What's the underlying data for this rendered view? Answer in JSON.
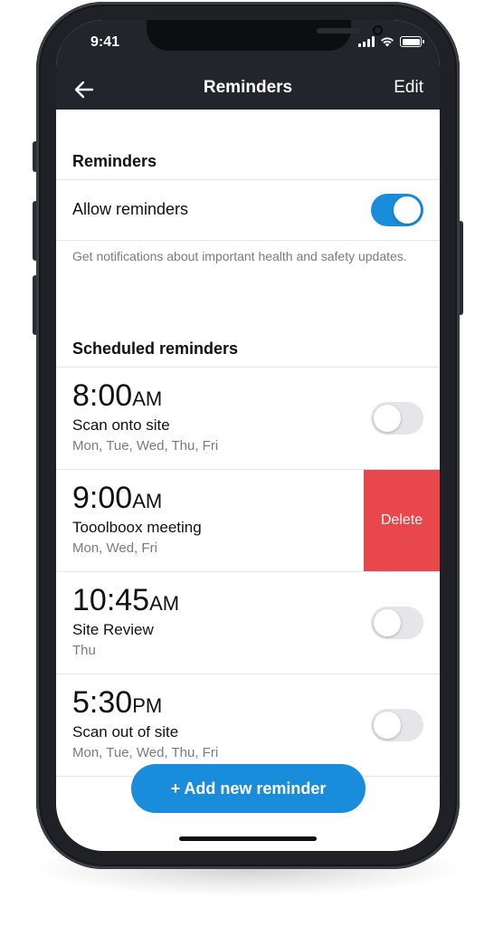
{
  "status_bar": {
    "time": "9:41"
  },
  "nav": {
    "title": "Reminders",
    "edit_label": "Edit"
  },
  "settings": {
    "heading": "Reminders",
    "allow_label": "Allow reminders",
    "allow_enabled": true,
    "hint": "Get notifications about important health and safety updates."
  },
  "scheduled": {
    "heading": "Scheduled reminders",
    "items": [
      {
        "time": "8:00",
        "period": "AM",
        "name": "Scan onto site",
        "days": "Mon, Tue, Wed, Thu, Fri",
        "enabled": false
      },
      {
        "time": "9:00",
        "period": "AM",
        "name": "Tooolboox meeting",
        "days": "Mon, Wed, Fri",
        "swiped": true,
        "delete_label": "Delete"
      },
      {
        "time": "10:45",
        "period": "AM",
        "name": "Site Review",
        "days": "Thu",
        "enabled": false
      },
      {
        "time": "5:30",
        "period": "PM",
        "name": "Scan out of site",
        "days": "Mon, Tue, Wed, Thu, Fri",
        "enabled": false
      }
    ]
  },
  "add_button": {
    "label": "+ Add new reminder"
  },
  "colors": {
    "accent": "#1a8cdc",
    "delete": "#e8474b",
    "nav_bg": "#22252b"
  }
}
